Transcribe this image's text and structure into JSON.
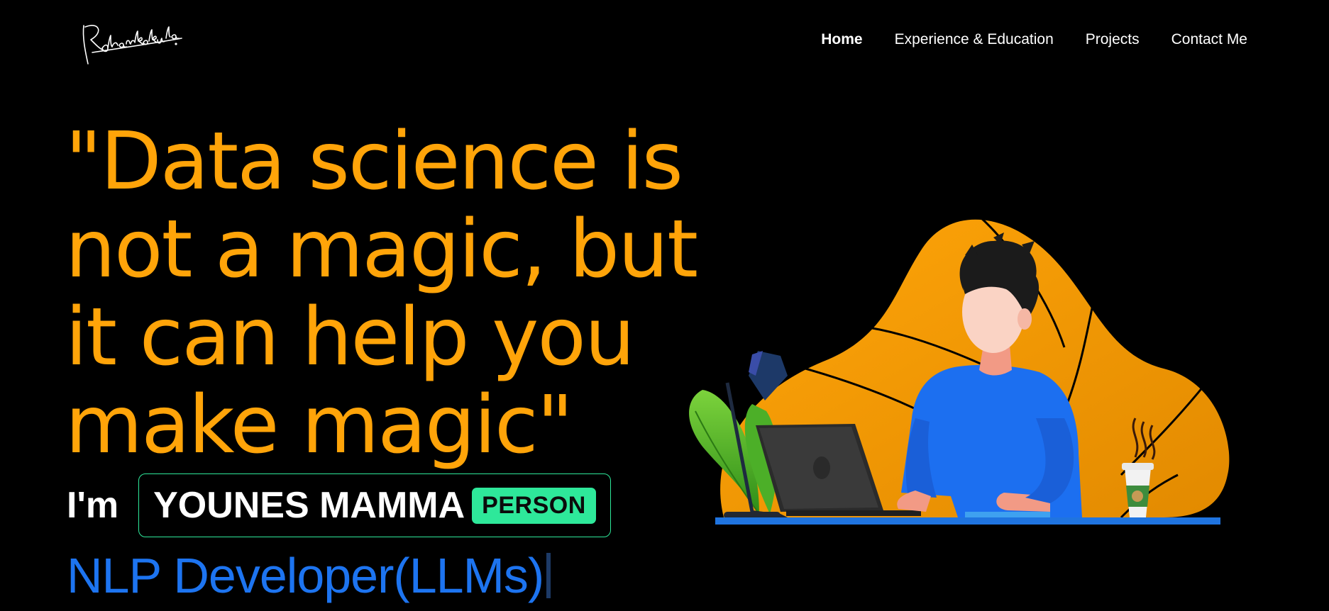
{
  "logo": {
    "alt": "signature logo"
  },
  "nav": {
    "items": [
      {
        "label": "Home",
        "active": true
      },
      {
        "label": "Experience & Education",
        "active": false
      },
      {
        "label": "Projects",
        "active": false
      },
      {
        "label": "Contact Me",
        "active": false
      }
    ]
  },
  "hero": {
    "quote_lines": [
      "\"Data science is",
      "not a magic, but",
      "it can help you",
      "make magic\""
    ],
    "im_label": "I'm",
    "entity_name": "YOUNES MAMMA",
    "entity_tag": "PERSON",
    "role": "NLP Developer(LLMs)"
  },
  "colors": {
    "background": "#000000",
    "accent_orange": "#ffa409",
    "accent_green": "#2ee89a",
    "accent_blue": "#1d74f0"
  }
}
